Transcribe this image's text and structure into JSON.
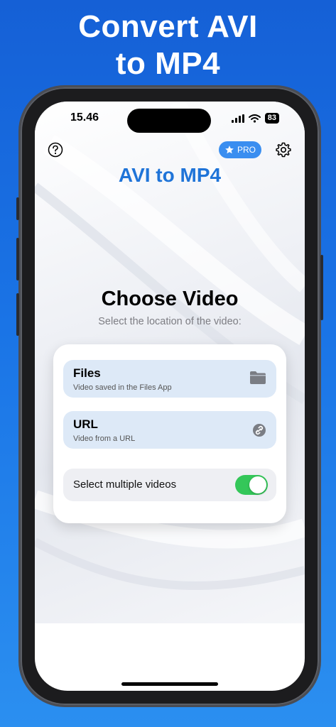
{
  "headline": {
    "line1": "Convert AVI",
    "line2": "to MP4"
  },
  "status": {
    "time": "15.46",
    "battery": "83"
  },
  "header": {
    "pro_label": "PRO",
    "title": "AVI to MP4"
  },
  "choose": {
    "title": "Choose Video",
    "subtitle": "Select the location of the video:"
  },
  "options": [
    {
      "title": "Files",
      "subtitle": "Video saved in the Files App",
      "icon": "folder-icon"
    },
    {
      "title": "URL",
      "subtitle": "Video from a URL",
      "icon": "link-icon"
    }
  ],
  "multi_select": {
    "label": "Select multiple videos",
    "enabled": true
  },
  "colors": {
    "accent": "#1f74d8",
    "toggle_on": "#34c759",
    "option_bg": "#dde9f7",
    "page_bg": "#1a74e6"
  }
}
